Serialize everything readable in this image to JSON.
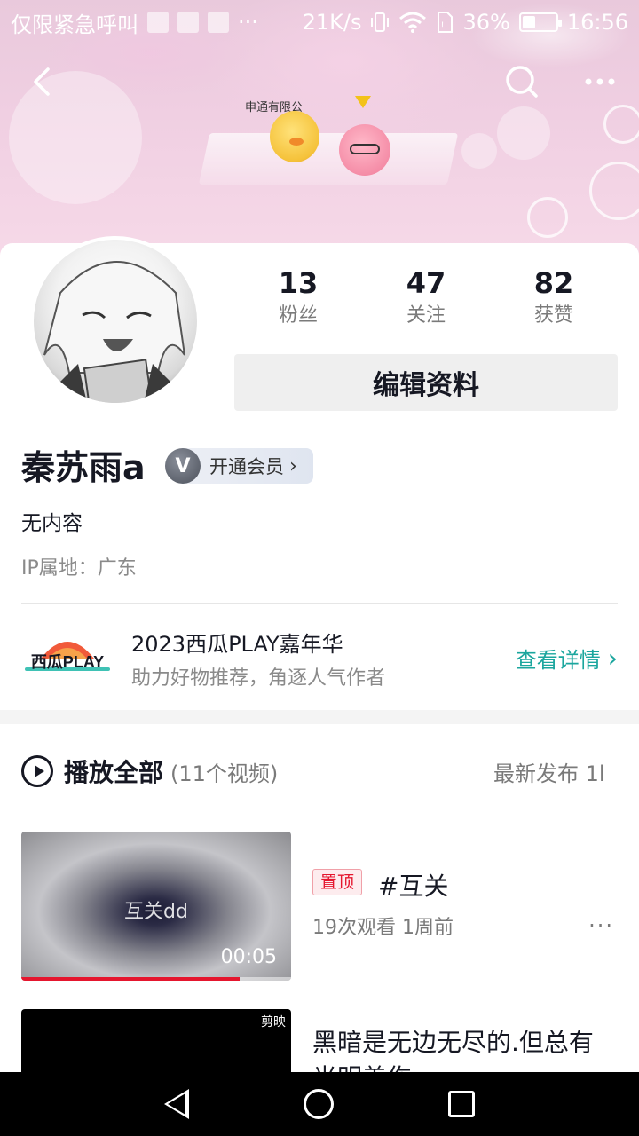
{
  "status_bar": {
    "carrier": "仅限紧急呼叫",
    "more": "···",
    "speed": "21K/s",
    "battery": "36%",
    "time": "16:56"
  },
  "banner": {
    "sponsor": "申通有限公"
  },
  "icons": {
    "back": "back-icon",
    "search": "search-icon",
    "more": "more-icon"
  },
  "profile": {
    "stats": [
      {
        "value": "13",
        "label": "粉丝"
      },
      {
        "value": "47",
        "label": "关注"
      },
      {
        "value": "82",
        "label": "获赞"
      }
    ],
    "edit_label": "编辑资料",
    "name": "秦苏雨a",
    "vip_label": "开通会员",
    "vip_arrow": "›",
    "bio": "无内容",
    "ip": "IP属地：广东"
  },
  "promo": {
    "logo_text": "西瓜PLAY",
    "title": "2023西瓜PLAY嘉年华",
    "subtitle": "助力好物推荐，角逐人气作者",
    "link": "查看详情",
    "link_arrow": "›"
  },
  "video_list": {
    "play_all": "播放全部",
    "count": "(11个视频)",
    "sort": "最新发布 1l",
    "videos": [
      {
        "thumb_text": "互关dd",
        "duration": "00:05",
        "progress": 0.81,
        "pinned_label": "置顶",
        "title": "#互关",
        "meta": "19次观看  1周前",
        "more": "···"
      },
      {
        "watermark": "剪映",
        "title": "黑暗是无边无尽的.但总有光明盖伤"
      }
    ]
  },
  "colors": {
    "accent": "#1ba69e",
    "pinned": "#e5162e"
  }
}
